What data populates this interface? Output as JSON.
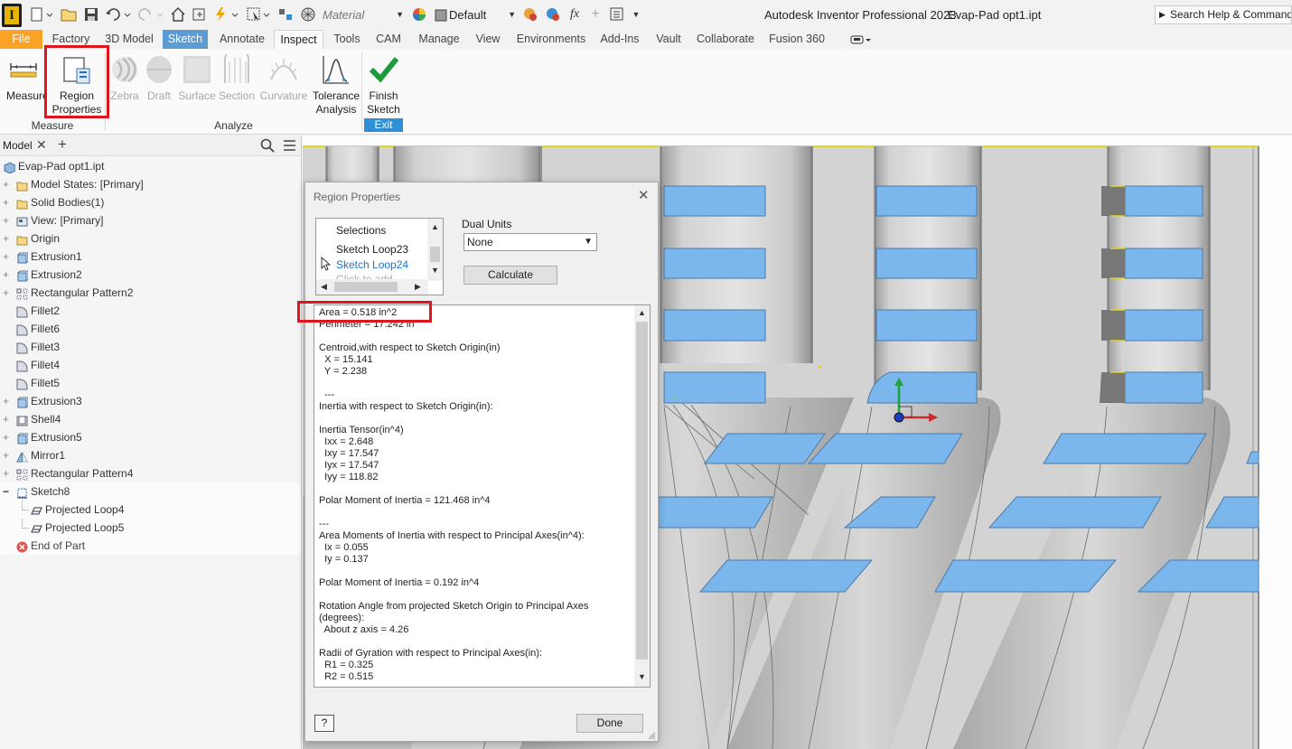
{
  "titlebar": {
    "logo_letter": "I",
    "material_placeholder": "Material",
    "appearance_value": "Default",
    "fx_label": "fx",
    "app_title": "Autodesk Inventor Professional 2023",
    "doc_title": "Evap-Pad opt1.ipt",
    "search_placeholder": "Search Help & Commands..."
  },
  "tabs": [
    "File",
    "Factory",
    "3D Model",
    "Sketch",
    "Annotate",
    "Inspect",
    "Tools",
    "CAM",
    "Manage",
    "View",
    "Environments",
    "Add-Ins",
    "Vault",
    "Collaborate",
    "Fusion 360"
  ],
  "ribbon": {
    "measure_label": "Measure",
    "region_properties_label_1": "Region",
    "region_properties_label_2": "Properties",
    "zebra_label": "Zebra",
    "draft_label": "Draft",
    "surface_label": "Surface",
    "section_label": "Section",
    "curvature_label": "Curvature",
    "tolerance_label_1": "Tolerance",
    "tolerance_label_2": "Analysis",
    "finish_label_1": "Finish",
    "finish_label_2": "Sketch",
    "panel_measure": "Measure",
    "panel_analyze": "Analyze",
    "panel_exit": "Exit"
  },
  "browser": {
    "tab_label": "Model",
    "items": [
      {
        "label": "Evap-Pad opt1.ipt",
        "icon": "part-icon"
      },
      {
        "label": "Model States: [Primary]",
        "icon": "folder-icon"
      },
      {
        "label": "Solid Bodies(1)",
        "icon": "folder-icon"
      },
      {
        "label": "View: [Primary]",
        "icon": "view-icon"
      },
      {
        "label": "Origin",
        "icon": "folder-icon"
      },
      {
        "label": "Extrusion1",
        "icon": "extrusion-icon"
      },
      {
        "label": "Extrusion2",
        "icon": "extrusion-icon"
      },
      {
        "label": "Rectangular Pattern2",
        "icon": "pattern-icon"
      },
      {
        "label": "Fillet2",
        "icon": "fillet-icon"
      },
      {
        "label": "Fillet6",
        "icon": "fillet-icon"
      },
      {
        "label": "Fillet3",
        "icon": "fillet-icon"
      },
      {
        "label": "Fillet4",
        "icon": "fillet-icon"
      },
      {
        "label": "Fillet5",
        "icon": "fillet-icon"
      },
      {
        "label": "Extrusion3",
        "icon": "extrusion-icon"
      },
      {
        "label": "Shell4",
        "icon": "shell-icon"
      },
      {
        "label": "Extrusion5",
        "icon": "extrusion-icon"
      },
      {
        "label": "Mirror1",
        "icon": "mirror-icon"
      },
      {
        "label": "Rectangular Pattern4",
        "icon": "pattern-icon"
      },
      {
        "label": "Sketch8",
        "icon": "sketch-icon"
      },
      {
        "label": "Projected Loop4",
        "icon": "loop-icon"
      },
      {
        "label": "Projected Loop5",
        "icon": "loop-icon"
      },
      {
        "label": "End of Part",
        "icon": "end-of-part-icon"
      }
    ]
  },
  "dialog": {
    "title": "Region Properties",
    "selections_header": "Selections",
    "selections": [
      "Sketch Loop23",
      "Sketch Loop24",
      "Click to add"
    ],
    "dual_units_label": "Dual Units",
    "dual_units_value": "None",
    "calculate_label": "Calculate",
    "results": "Area = 0.518 in^2\nPerimeter = 17.242 in\n\nCentroid,with respect to Sketch Origin(in)\n  X = 15.141\n  Y = 2.238\n\n  ---\nInertia with respect to Sketch Origin(in):\n\nInertia Tensor(in^4)\n  Ixx = 2.648\n  Ixy = 17.547\n  Iyx = 17.547\n  Iyy = 118.82\n\nPolar Moment of Inertia = 121.468 in^4\n\n---\nArea Moments of Inertia with respect to Principal Axes(in^4):\n  Ix = 0.055\n  Iy = 0.137\n\nPolar Moment of Inertia = 0.192 in^4\n\nRotation Angle from projected Sketch Origin to Principal Axes\n(degrees):\n  About z axis = 4.26\n\nRadii of Gyration with respect to Principal Axes(in):\n  R1 = 0.325\n  R2 = 0.515",
    "help_label": "?",
    "done_label": "Done"
  },
  "colors": {
    "highlight": "#e0141c",
    "slot_blue": "#6fb2ea",
    "sketch_tab": "#5d9bd3",
    "file_tab": "#f8a226",
    "exit_blue": "#2d8fd6"
  }
}
